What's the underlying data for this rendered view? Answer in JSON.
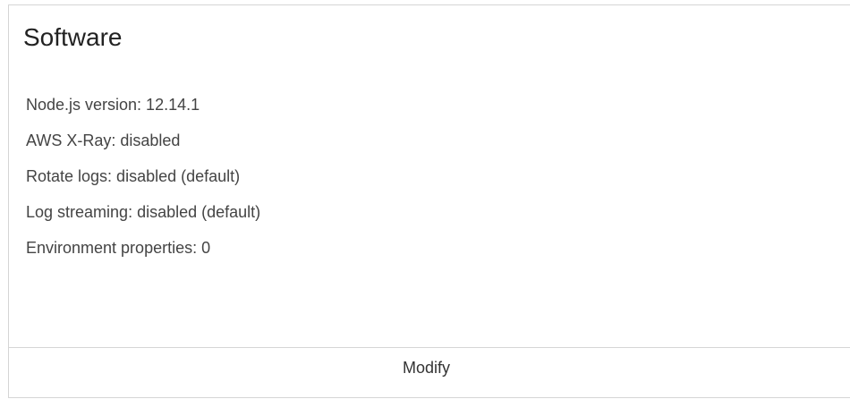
{
  "card": {
    "title": "Software",
    "properties": [
      {
        "label": "Node.js version",
        "value": "12.14.1",
        "text": "Node.js version: 12.14.1"
      },
      {
        "label": "AWS X-Ray",
        "value": "disabled",
        "text": "AWS X-Ray: disabled"
      },
      {
        "label": "Rotate logs",
        "value": "disabled (default)",
        "text": "Rotate logs: disabled (default)"
      },
      {
        "label": "Log streaming",
        "value": "disabled (default)",
        "text": "Log streaming: disabled (default)"
      },
      {
        "label": "Environment properties",
        "value": "0",
        "text": "Environment properties: 0"
      }
    ],
    "modify_label": "Modify"
  }
}
